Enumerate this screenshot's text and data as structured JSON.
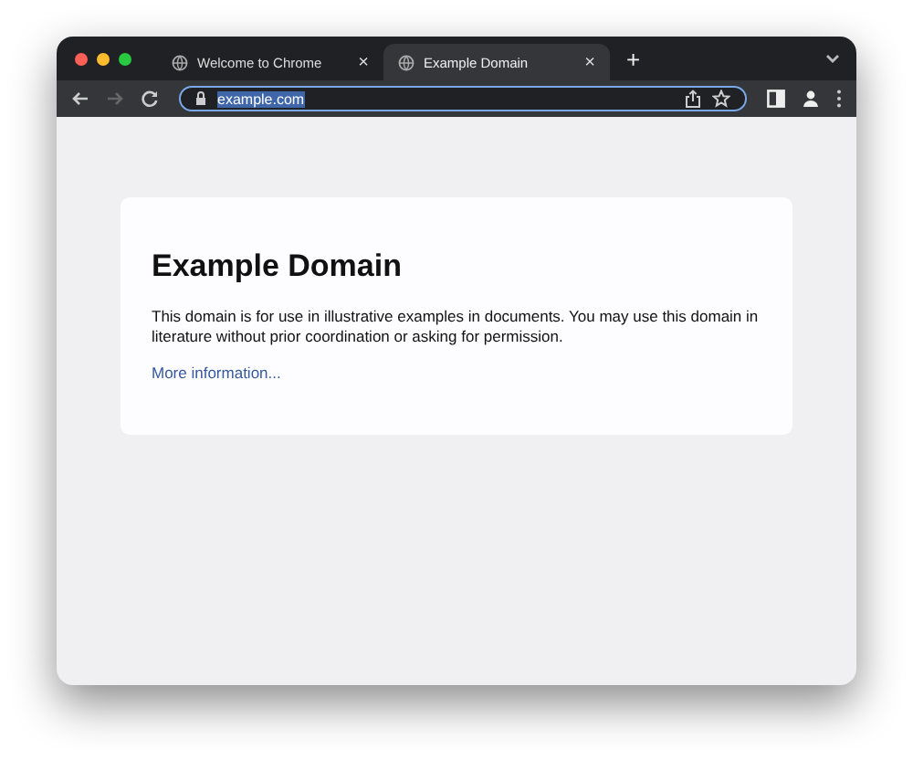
{
  "tabs": [
    {
      "title": "Welcome to Chrome",
      "close": "×",
      "selected": false
    },
    {
      "title": "Example Domain",
      "close": "×",
      "selected": true
    }
  ],
  "new_tab": "+",
  "address_bar": {
    "url": "example.com",
    "highlighted": true
  },
  "page": {
    "heading": "Example Domain",
    "paragraph": "This domain is for use in illustrative examples in documents. You may use this domain in literature without prior coordination or asking for permission.",
    "link": "More information..."
  }
}
